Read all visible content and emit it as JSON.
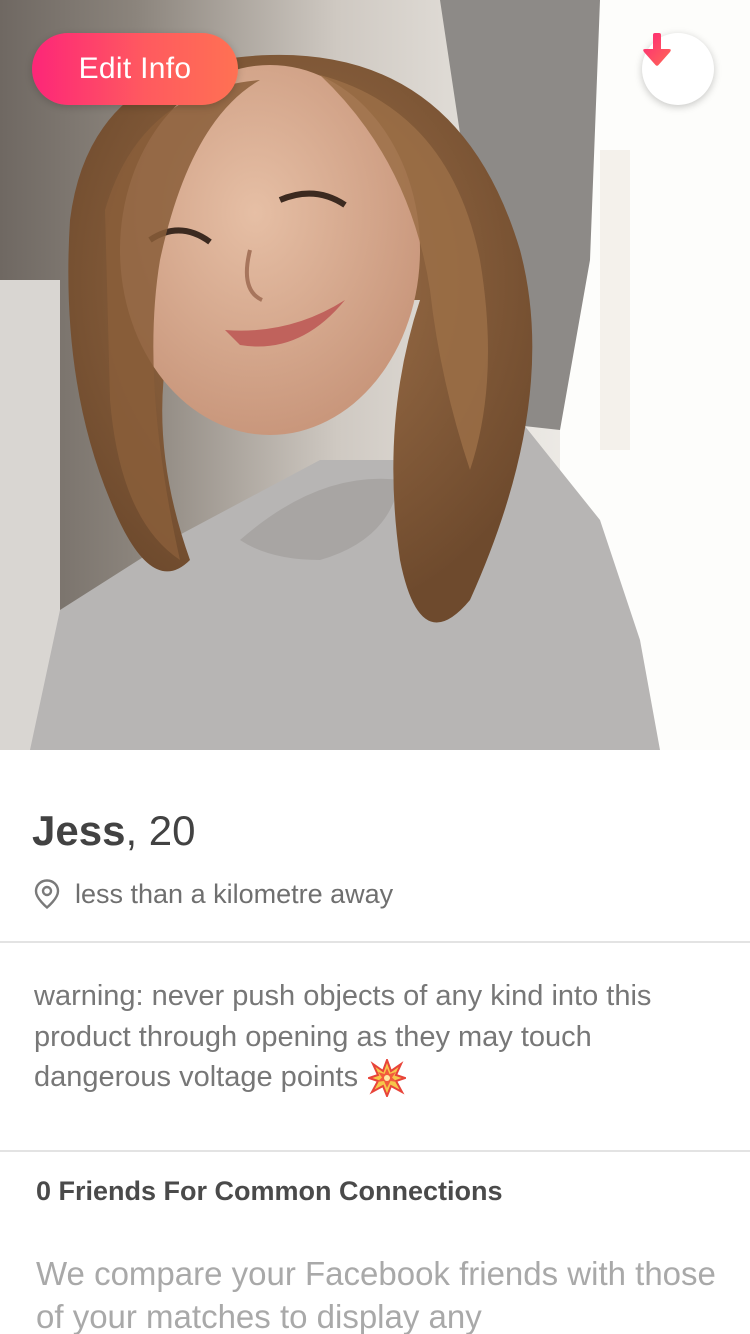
{
  "header": {
    "edit_info_label": "Edit Info",
    "collapse_icon": "arrow-down-icon",
    "accent_color": "#fd2678"
  },
  "profile": {
    "name": "Jess",
    "age_text": ", 20",
    "location_icon": "location-pin-icon",
    "distance": "less than a kilometre away",
    "bio": "warning: never push objects of any kind into this product through opening as they may touch dangerous voltage points",
    "bio_emoji": "collision-emoji-icon"
  },
  "connections": {
    "title": "0 Friends For Common Connections",
    "description": "We compare your Facebook friends with those of your matches to display any"
  }
}
